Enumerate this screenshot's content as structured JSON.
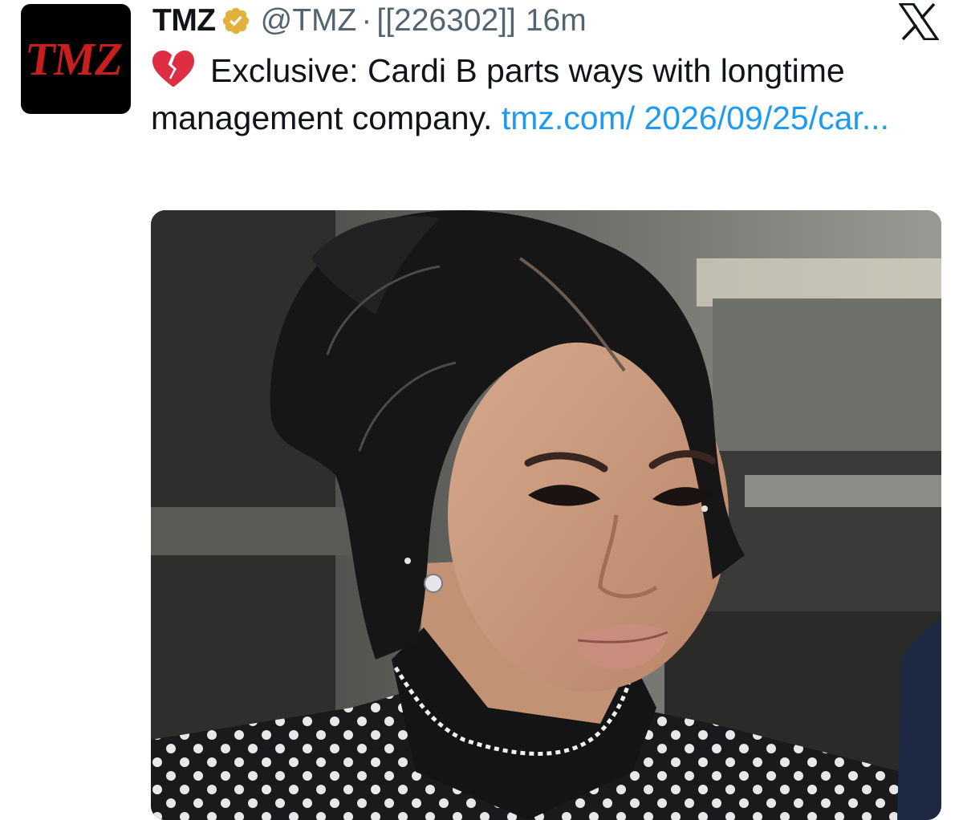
{
  "author": {
    "display_name": "TMZ",
    "handle": "@TMZ",
    "separator": "·",
    "post_id": "[[226302]]",
    "timestamp": "16m",
    "avatar_text": "TMZ",
    "avatar_colors": {
      "background": "#000000",
      "logo": "#d01f1f"
    },
    "verified_badge_color": "#e8b634"
  },
  "platform": {
    "logo_icon": "x-logo-icon"
  },
  "post": {
    "emoji_icon": "broken-heart-icon",
    "text": "Exclusive: Cardi B parts ways with longtime management company.",
    "link_text": "tmz.com/ 2026/09/25/car..."
  },
  "media": {
    "type": "photo"
  },
  "colors": {
    "text": "#0f1419",
    "secondary": "#536471",
    "link": "#1d9bf0"
  }
}
